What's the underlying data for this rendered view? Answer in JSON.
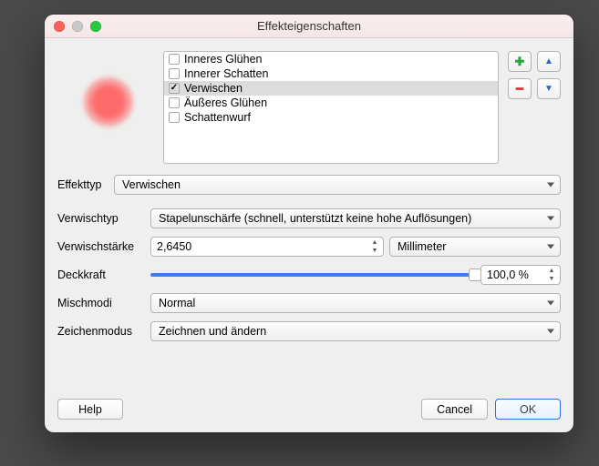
{
  "window": {
    "title": "Effekteigenschaften"
  },
  "effects": [
    {
      "label": "Inneres Glühen",
      "checked": false,
      "selected": false
    },
    {
      "label": "Innerer Schatten",
      "checked": false,
      "selected": false
    },
    {
      "label": "Verwischen",
      "checked": true,
      "selected": true
    },
    {
      "label": "Äußeres Glühen",
      "checked": false,
      "selected": false
    },
    {
      "label": "Schattenwurf",
      "checked": false,
      "selected": false
    }
  ],
  "side_icons": {
    "add": {
      "glyph": "✚",
      "name": "add-effect-icon"
    },
    "up": {
      "glyph": "▲",
      "name": "move-up-icon"
    },
    "remove": {
      "glyph": "━",
      "name": "remove-effect-icon"
    },
    "down": {
      "glyph": "▼",
      "name": "move-down-icon"
    }
  },
  "labels": {
    "effekttyp": "Effekttyp",
    "verwischtyp": "Verwischtyp",
    "verwischstaerke": "Verwischstärke",
    "deckkraft": "Deckkraft",
    "mischmodi": "Mischmodi",
    "zeichenmodus": "Zeichenmodus"
  },
  "values": {
    "effekttyp": "Verwischen",
    "verwischtyp": "Stapelunschärfe (schnell, unterstützt keine hohe Auflösungen)",
    "verwischstaerke": "2,6450",
    "verwischstaerke_unit": "Millimeter",
    "deckkraft": "100,0 %",
    "mischmodi": "Normal",
    "zeichenmodus": "Zeichnen und ändern"
  },
  "buttons": {
    "help": "Help",
    "cancel": "Cancel",
    "ok": "OK"
  },
  "colors": {
    "accent": "#3b7ff5",
    "preview_fill": "#ff6b6b"
  }
}
